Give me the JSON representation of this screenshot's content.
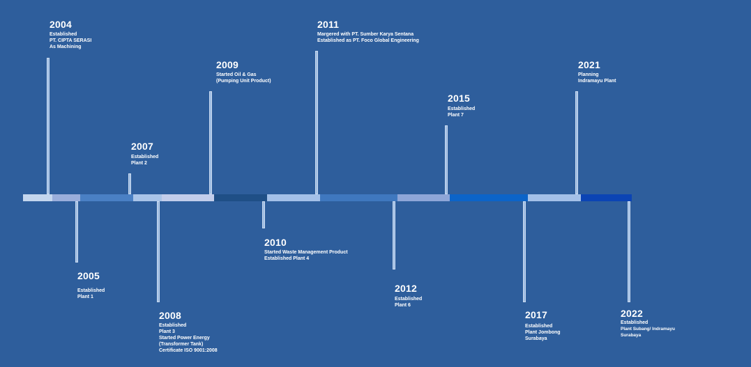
{
  "colors": {
    "background": "#2e5e9c",
    "stem_fill": "#9fbde3",
    "stem_border": "#c9daf0"
  },
  "milestones": [
    {
      "year": "2004",
      "lines": [
        "Established",
        "PT. CIPTA SERASI",
        "As Machining"
      ],
      "side": "up"
    },
    {
      "year": "2005",
      "lines": [
        "Established",
        "Plant 1"
      ],
      "side": "down"
    },
    {
      "year": "2007",
      "lines": [
        "Established",
        "Plant 2"
      ],
      "side": "up"
    },
    {
      "year": "2008",
      "lines": [
        "Established",
        "Plant 3",
        "Started Power Energy",
        "(Transformer Tank)",
        "Certificate ISO 9001:2008"
      ],
      "side": "down"
    },
    {
      "year": "2009",
      "lines": [
        "Started Oil & Gas",
        "(Pumping Unit Product)"
      ],
      "side": "up"
    },
    {
      "year": "2010",
      "lines": [
        "Started Waste Management Product",
        "Established Plant 4"
      ],
      "side": "down"
    },
    {
      "year": "2011",
      "lines": [
        "Margered with PT. Sumber Karya Sentana",
        "Established as PT. Foco Global Engineering"
      ],
      "side": "up"
    },
    {
      "year": "2012",
      "lines": [
        "Established",
        "Plant 6"
      ],
      "side": "down"
    },
    {
      "year": "2015",
      "lines": [
        "Established",
        "Plant 7"
      ],
      "side": "up"
    },
    {
      "year": "2017",
      "lines": [
        "Established",
        "Plant Jombong",
        "Surabaya"
      ],
      "side": "down"
    },
    {
      "year": "2021",
      "lines": [
        "Planning",
        "Indramayu Plant"
      ],
      "side": "up"
    },
    {
      "year": "2022",
      "lines": [
        "Established",
        "Plant Subang/ Indramayu",
        "Surabaya"
      ],
      "side": "down"
    }
  ]
}
